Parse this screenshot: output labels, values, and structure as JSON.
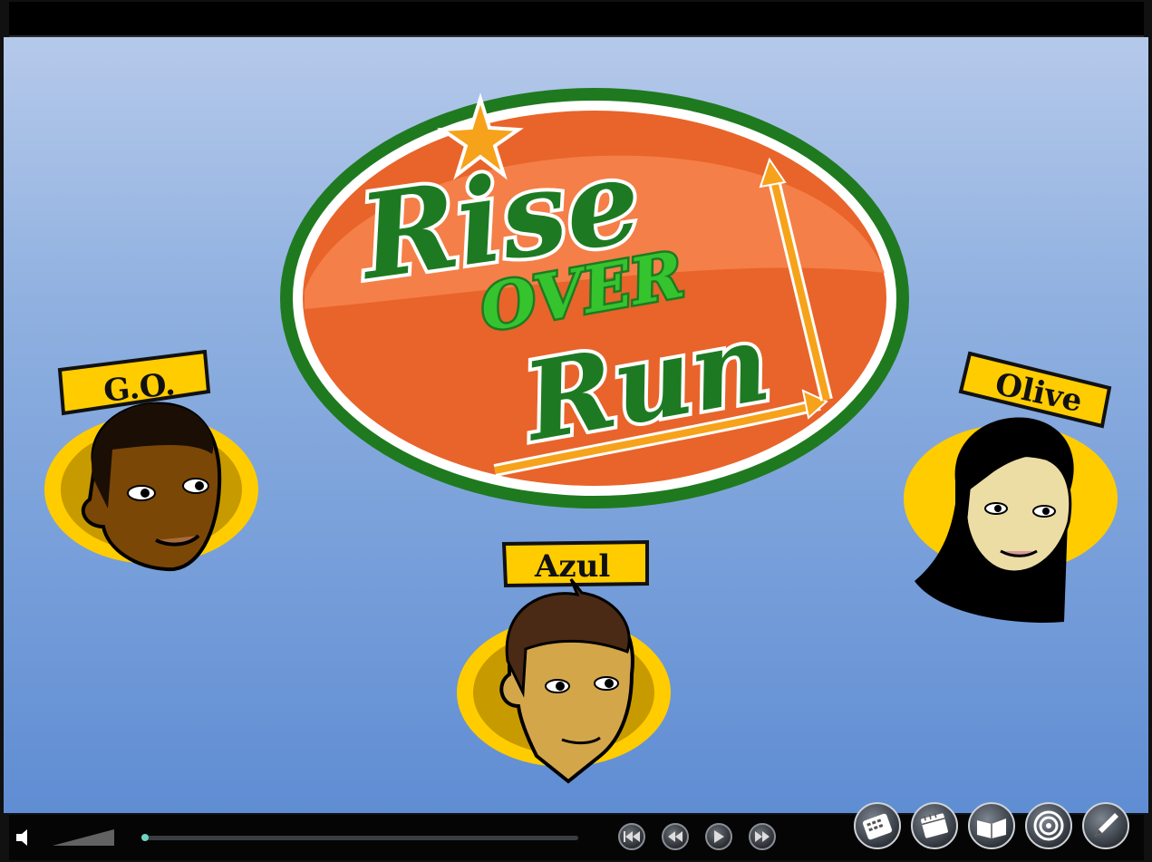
{
  "title": {
    "word1": "Rise",
    "word2": "OVER",
    "word3": "Run"
  },
  "characters": [
    {
      "name": "G.O."
    },
    {
      "name": "Azul"
    },
    {
      "name": "Olive"
    }
  ],
  "player": {
    "progress": 0.0,
    "volume_level": 1.0,
    "controls": [
      "rewind-to-start",
      "rewind",
      "play",
      "fast-forward"
    ],
    "tools": [
      "calculator-icon",
      "calendar-icon",
      "book-icon",
      "target-icon",
      "pencil-icon"
    ]
  },
  "colors": {
    "logo_green": "#1f7a1f",
    "logo_orange": "#f26b2e",
    "nameplate_yellow": "#ffcc00",
    "stage_top": "#b5c9ea",
    "stage_bottom": "#5f8dd3"
  }
}
